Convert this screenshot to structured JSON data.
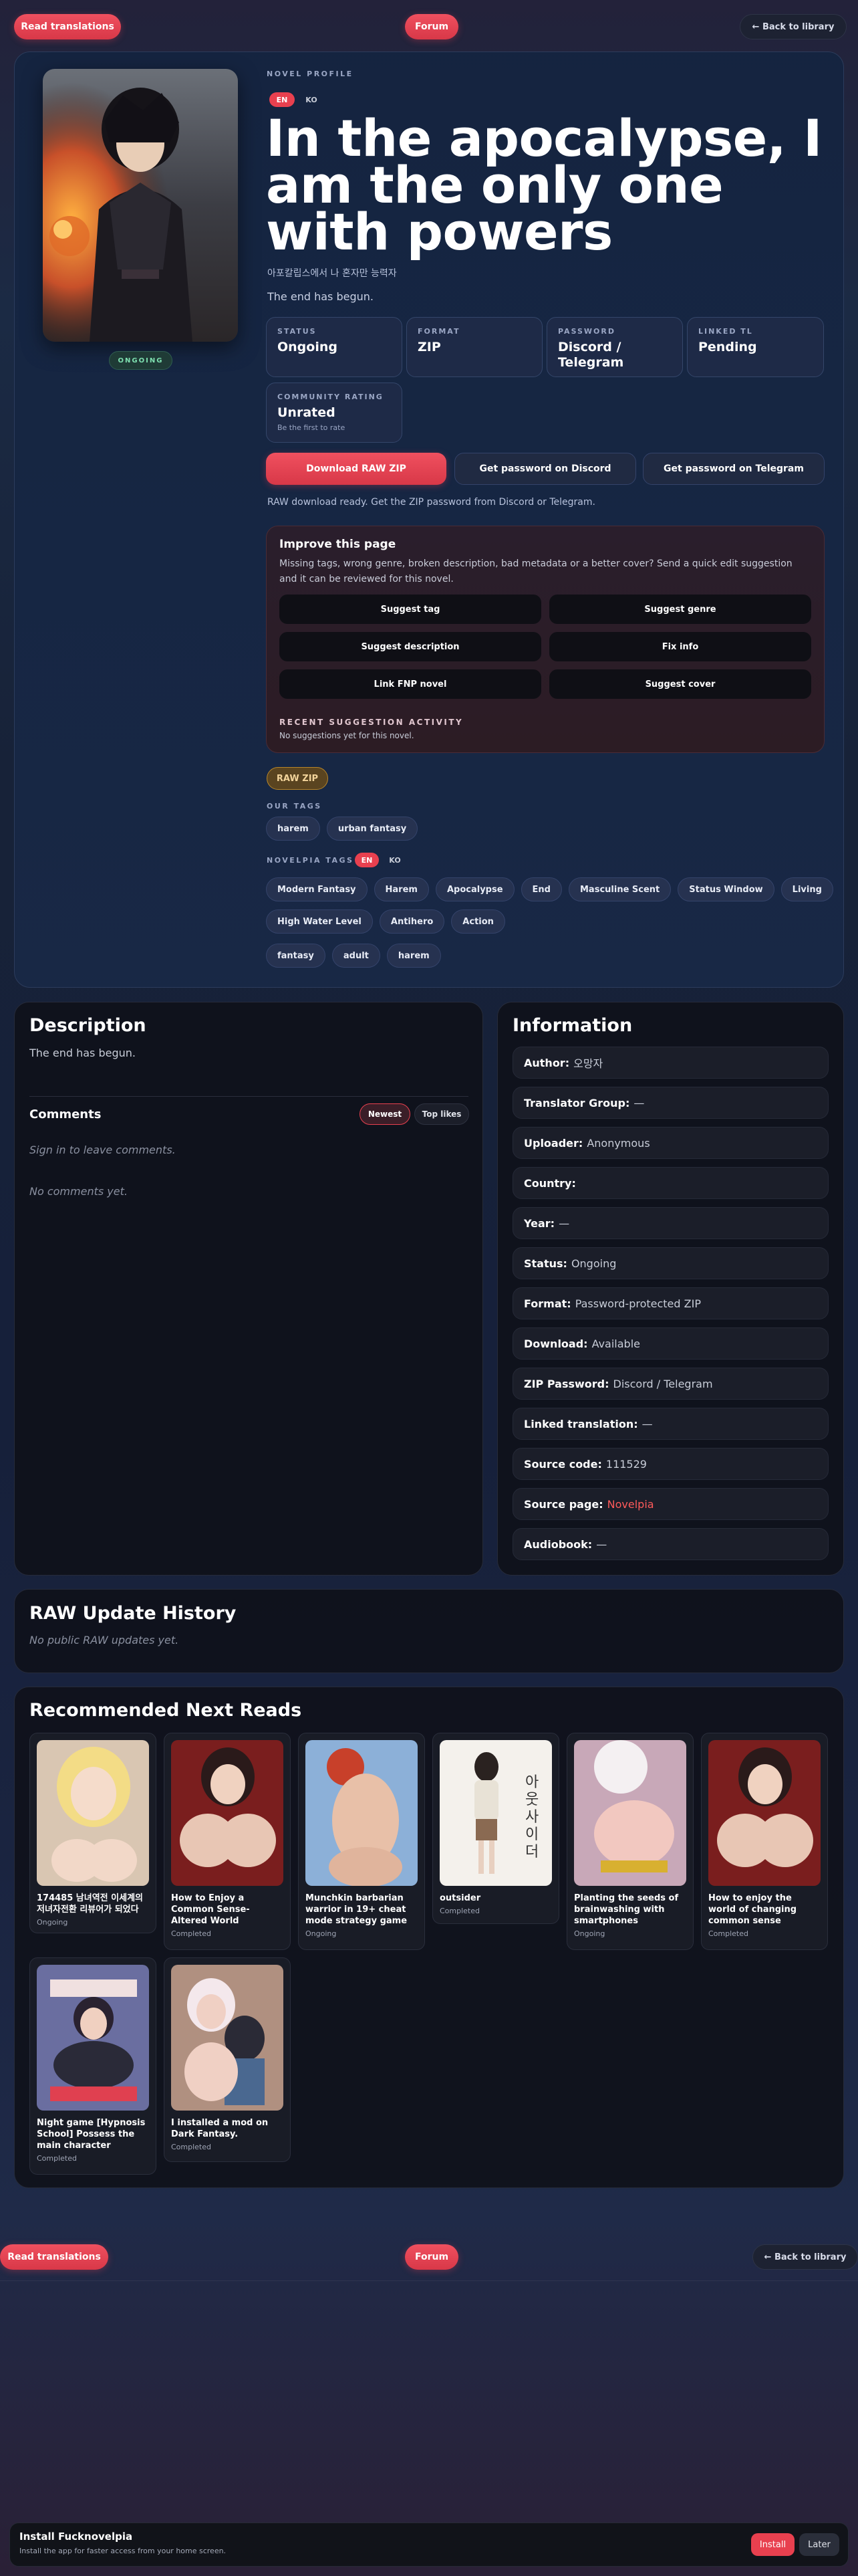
{
  "top_nav": {
    "left": "Read translations",
    "center": "Forum",
    "right": "← Back to library"
  },
  "hero": {
    "section_label": "NOVEL PROFILE",
    "lang_active": "EN",
    "lang_other": "KO",
    "title": "In the apocalypse, I am the only one with powers",
    "korean_title": "아포칼립스에서 나 혼자만 능력자",
    "tagline": "The end has begun.",
    "cover_badge": "ONGOING",
    "stats": [
      {
        "label": "STATUS",
        "value": "Ongoing"
      },
      {
        "label": "FORMAT",
        "value": "ZIP"
      },
      {
        "label": "PASSWORD",
        "value": "Discord / Telegram"
      },
      {
        "label": "LINKED TL",
        "value": "Pending"
      }
    ],
    "rating": {
      "label": "COMMUNITY RATING",
      "value": "Unrated",
      "sub": "Be the first to rate"
    },
    "actions": {
      "download": "Download RAW ZIP",
      "discord": "Get password on Discord",
      "telegram": "Get password on Telegram"
    },
    "download_note": "RAW download ready. Get the ZIP password from Discord or Telegram.",
    "improve": {
      "title": "Improve this page",
      "desc": "Missing tags, wrong genre, broken description, bad metadata or a better cover? Send a quick edit suggestion and it can be reviewed for this novel.",
      "buttons": [
        "Suggest tag",
        "Suggest genre",
        "Suggest description",
        "Fix info",
        "Link FNP novel",
        "Suggest cover"
      ],
      "activity_label": "RECENT SUGGESTION ACTIVITY",
      "activity_text": "No suggestions yet for this novel."
    },
    "raw_zip_badge": "RAW ZIP",
    "our_tags_label": "OUR TAGS",
    "our_tags": [
      "harem",
      "urban fantasy"
    ],
    "novelpia_tags_label": "NOVELPIA TAGS",
    "novelpia_tags_row1": [
      "Modern Fantasy",
      "Harem",
      "Apocalypse",
      "End",
      "Masculine Scent",
      "Status Window",
      "Living"
    ],
    "novelpia_tags_row2": [
      "High Water Level",
      "Antihero",
      "Action"
    ],
    "novelpia_tags_row3": [
      "fantasy",
      "adult",
      "harem"
    ]
  },
  "description": {
    "title": "Description",
    "text": "The end has begun."
  },
  "comments": {
    "title": "Comments",
    "sort_active": "Newest",
    "sort_other": "Top likes",
    "signin": "Sign in to leave comments.",
    "empty": "No comments yet."
  },
  "information": {
    "title": "Information",
    "rows": [
      {
        "label": "Author:",
        "value": "오망자"
      },
      {
        "label": "Translator Group:",
        "value": "—"
      },
      {
        "label": "Uploader:",
        "value": "Anonymous"
      },
      {
        "label": "Country:",
        "value": ""
      },
      {
        "label": "Year:",
        "value": "—"
      },
      {
        "label": "Status:",
        "value": "Ongoing"
      },
      {
        "label": "Format:",
        "value": "Password-protected ZIP"
      },
      {
        "label": "Download:",
        "value": "Available"
      },
      {
        "label": "ZIP Password:",
        "value": "Discord / Telegram"
      },
      {
        "label": "Linked translation:",
        "value": "—"
      },
      {
        "label": "Source code:",
        "value": "111529"
      },
      {
        "label": "Source page:",
        "value": "Novelpia"
      },
      {
        "label": "Audiobook:",
        "value": "—"
      }
    ]
  },
  "raw_history": {
    "title": "RAW Update History",
    "text": "No public RAW updates yet."
  },
  "recommended": {
    "title": "Recommended Next Reads",
    "items": [
      {
        "title": "174485 남녀역전 이세계의 저녀자전환 리뷰어가 되었다",
        "status": "Ongoing"
      },
      {
        "title": "How to Enjoy a Common Sense-Altered World",
        "status": "Completed"
      },
      {
        "title": "Munchkin barbarian warrior in 19+ cheat mode strategy game",
        "status": "Ongoing"
      },
      {
        "title": "outsider",
        "status": "Completed"
      },
      {
        "title": "Planting the seeds of brainwashing with smartphones",
        "status": "Ongoing"
      },
      {
        "title": "How to enjoy the world of changing common sense",
        "status": "Completed"
      },
      {
        "title": "Night game [Hypnosis School] Possess the main character",
        "status": "Completed"
      },
      {
        "title": "I installed a mod on Dark Fantasy.",
        "status": "Completed"
      }
    ]
  },
  "bottom_nav": {
    "left": "Read translations",
    "center": "Forum",
    "right": "← Back to library"
  },
  "install": {
    "title": "Install Fucknovelpia",
    "desc": "Install the app for faster access from your home screen.",
    "install": "Install",
    "later": "Later"
  },
  "colors": {
    "accent": "#e8404f",
    "link": "#ff5a5a",
    "badge_green": "#7ee0b0"
  }
}
